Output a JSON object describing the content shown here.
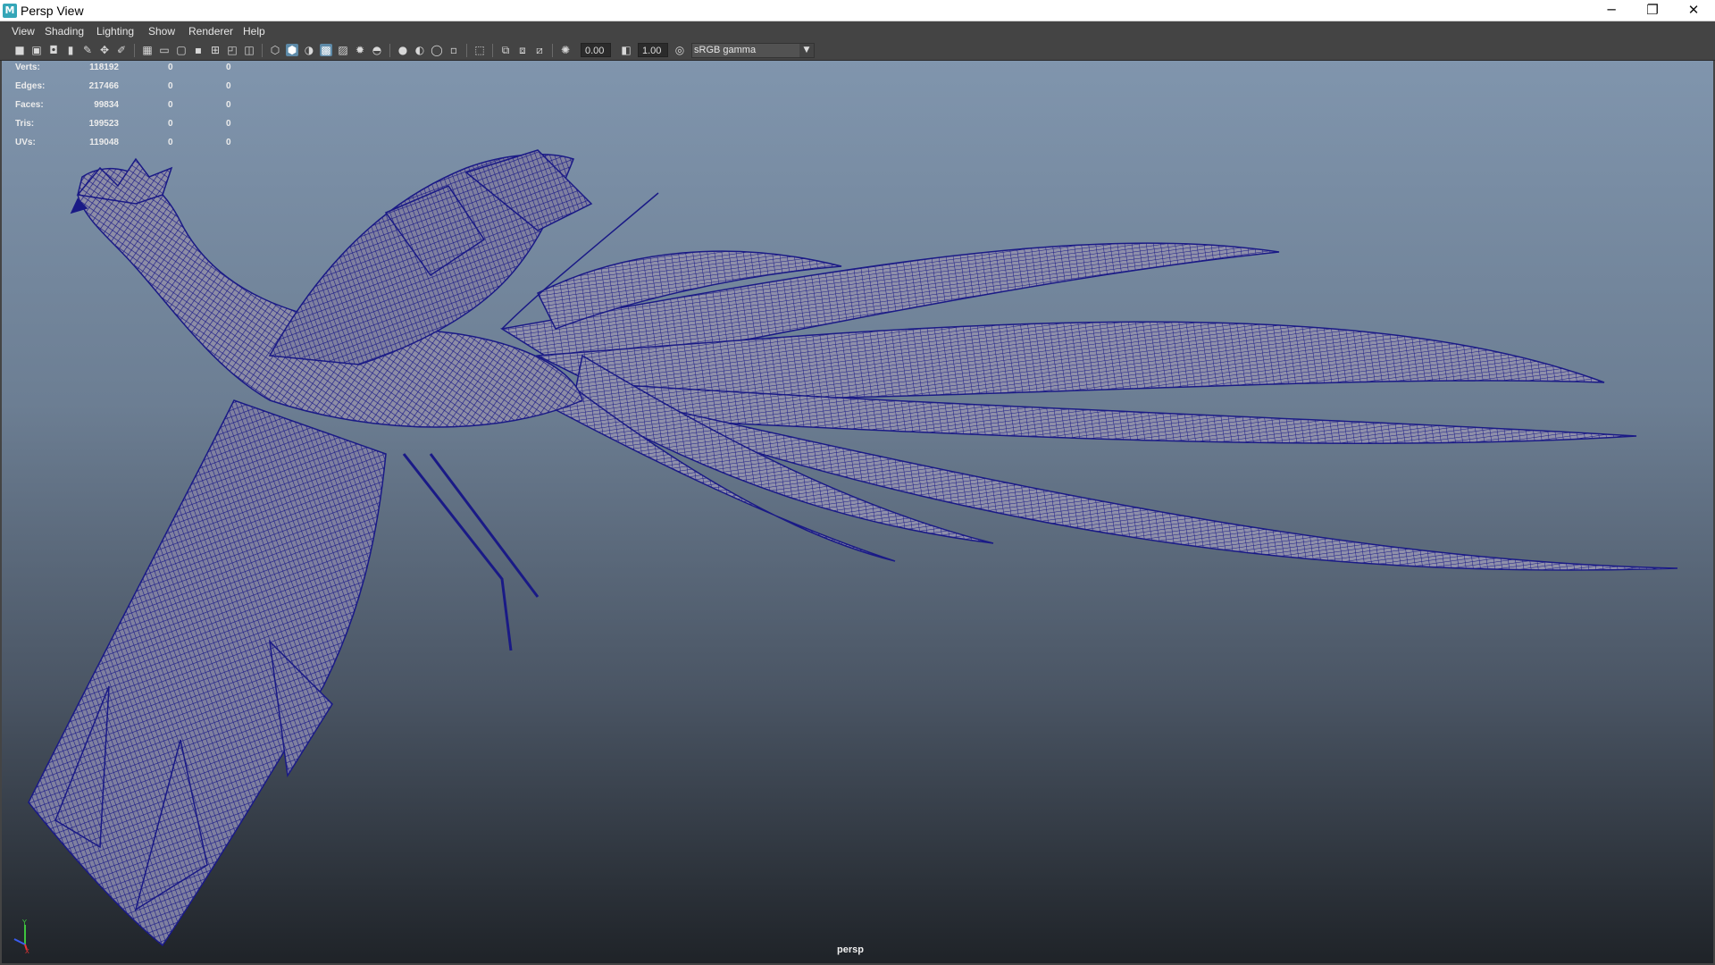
{
  "window": {
    "title": "Persp View",
    "app_icon": "M",
    "minimize": "─",
    "maximize": "❐",
    "close": "✕"
  },
  "menu": {
    "items": [
      "View",
      "Shading",
      "Lighting",
      "Show",
      "Renderer",
      "Help"
    ]
  },
  "toolbar": {
    "exposure_value": "0.00",
    "gamma_value": "1.00",
    "color_space": "sRGB gamma"
  },
  "hud": {
    "rows": [
      {
        "label": "Verts:",
        "v1": "118192",
        "v2": "0",
        "v3": "0"
      },
      {
        "label": "Edges:",
        "v1": "217466",
        "v2": "0",
        "v3": "0"
      },
      {
        "label": "Faces:",
        "v1": "99834",
        "v2": "0",
        "v3": "0"
      },
      {
        "label": "Tris:",
        "v1": "199523",
        "v2": "0",
        "v3": "0"
      },
      {
        "label": "UVs:",
        "v1": "119048",
        "v2": "0",
        "v3": "0"
      }
    ]
  },
  "viewport": {
    "camera_label": "persp",
    "axis_y": "Y",
    "axis_x": "X",
    "model_color": "#1a1a86",
    "background_top": "#8095ad",
    "background_bottom": "#1f2328"
  }
}
